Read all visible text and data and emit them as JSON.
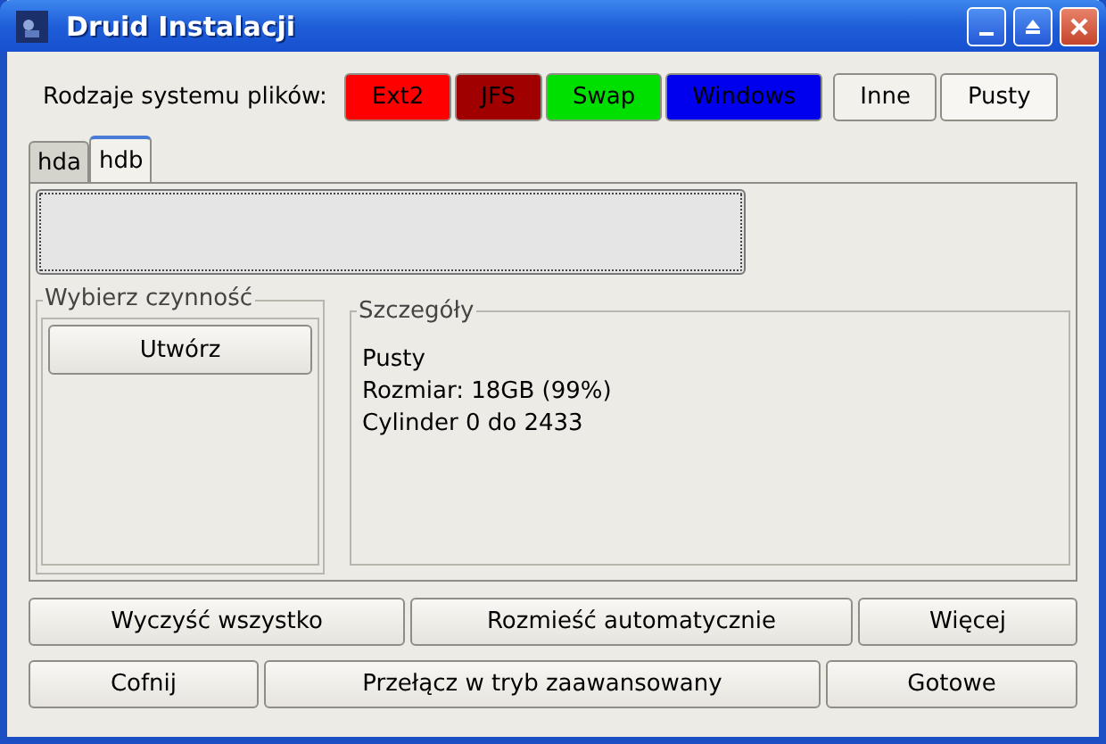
{
  "window": {
    "title": "Druid Instalacji"
  },
  "filesystems": {
    "label": "Rodzaje systemu plików:",
    "types": [
      {
        "label": "Ext2",
        "color": "#ff0000"
      },
      {
        "label": "JFS",
        "color": "#a00000"
      },
      {
        "label": "Swap",
        "color": "#00e000"
      },
      {
        "label": "Windows",
        "color": "#0000ee"
      },
      {
        "label": "Inne",
        "color": "#f2f1ec"
      },
      {
        "label": "Pusty",
        "color": "#f7f6f3"
      }
    ]
  },
  "tabs": [
    {
      "label": "hda",
      "selected": false
    },
    {
      "label": "hdb",
      "selected": true
    }
  ],
  "actions": {
    "title": "Wybierz czynność",
    "buttons": [
      "Utwórz"
    ]
  },
  "details": {
    "title": "Szczegóły",
    "lines": [
      "Pusty",
      "Rozmiar: 18GB (99%)",
      "Cylinder 0 do 2433"
    ]
  },
  "buttons_row1": [
    "Wyczyść wszystko",
    "Rozmieść automatycznie",
    "Więcej"
  ],
  "buttons_row2": [
    "Cofnij",
    "Przełącz w tryb zaawansowany",
    "Gotowe"
  ]
}
